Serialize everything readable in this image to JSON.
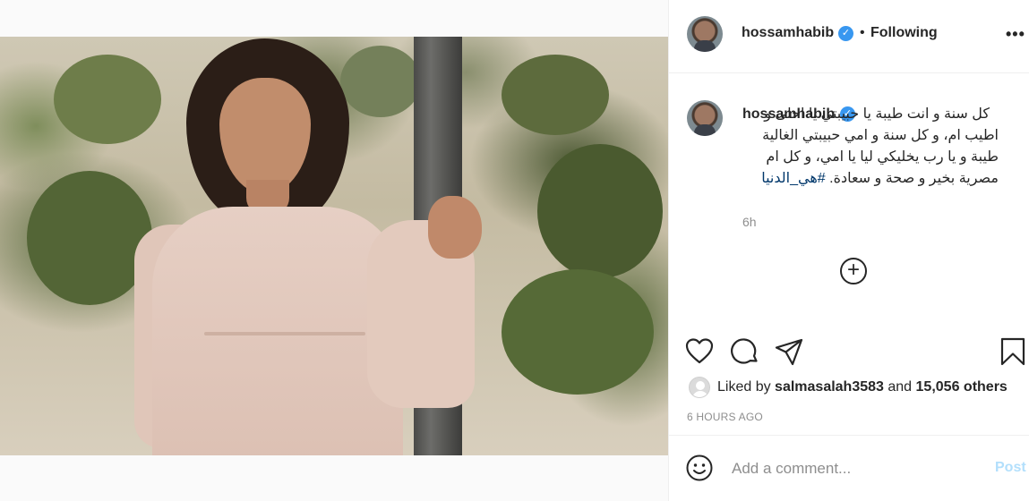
{
  "post": {
    "author": {
      "username": "hossamhabib",
      "verified": true,
      "follow_separator": "•",
      "follow_status": "Following"
    },
    "more_label": "•••",
    "caption": {
      "username": "hossamhabib",
      "text": "كل سنة و انت طيبة يا حبيبتي يا احلى و اطيب ام، و كل سنة و امي حبيبتي الغالية طيبة و يا رب يخليكي ليا يا امي، و كل ام مصرية بخير و صحة و سعادة.",
      "hashtag": "#هي_الدنيا",
      "time": "6h"
    },
    "load_more_label": "+",
    "likes": {
      "prefix": "Liked by",
      "liker": "salmasalah3583",
      "conjunction": "and",
      "others": "15,056 others"
    },
    "timestamp": "6 HOURS AGO",
    "comment": {
      "placeholder": "Add a comment...",
      "value": "",
      "post_label": "Post"
    },
    "colors": {
      "verified": "#3897f0",
      "hashtag": "#00376b",
      "post_disabled": "#b2dffc",
      "secondary_text": "#8e8e8e"
    },
    "icons": [
      "heart-icon",
      "comment-icon",
      "share-icon",
      "save-icon",
      "plus-circle-icon",
      "emoji-icon",
      "verified-badge-icon",
      "more-options-icon"
    ]
  }
}
